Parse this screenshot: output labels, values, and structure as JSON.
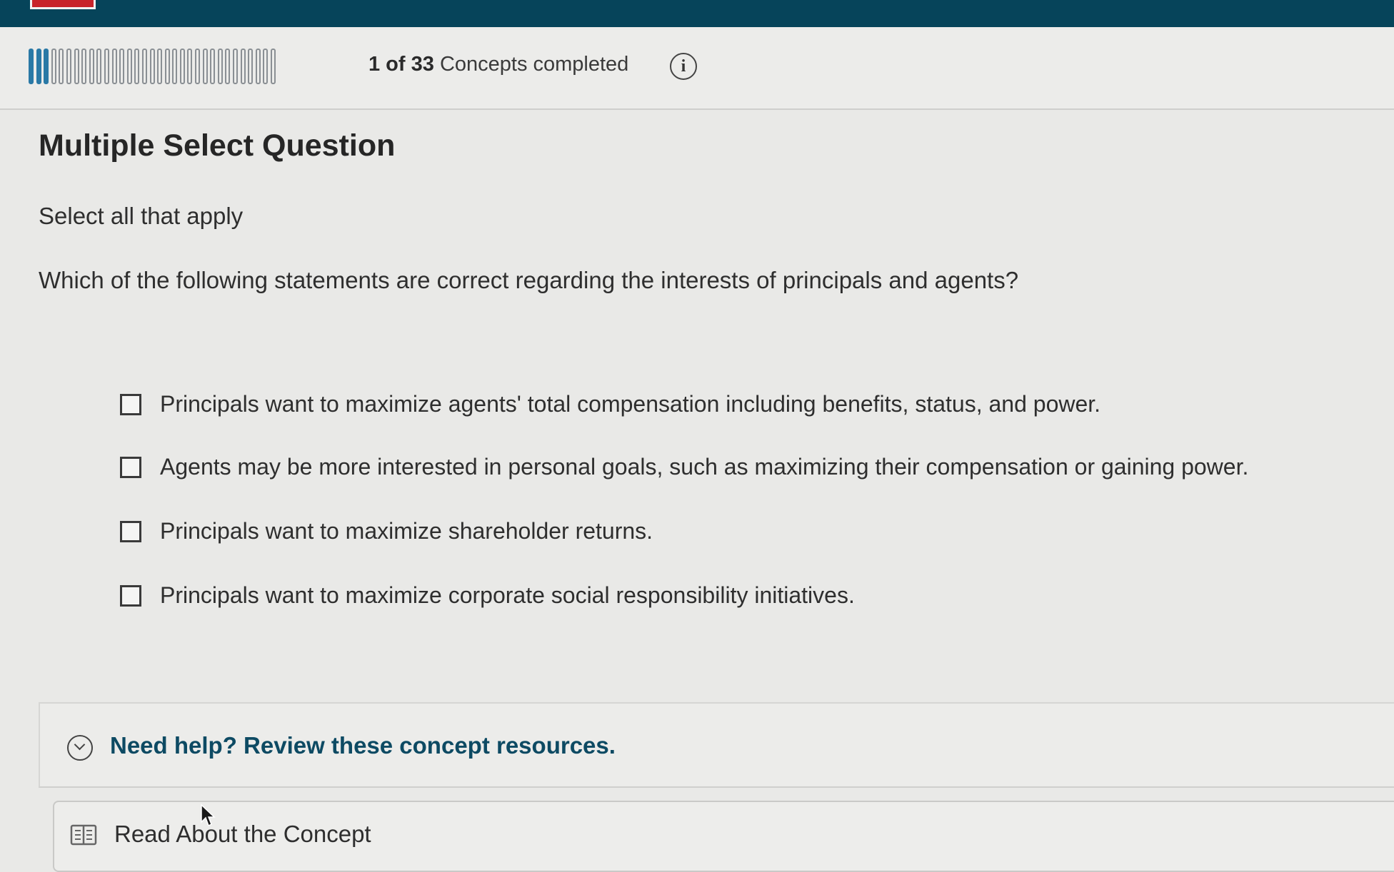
{
  "progress": {
    "completed_count": "1 of 33",
    "label": "Concepts completed",
    "completed": 1,
    "total": 33
  },
  "question": {
    "heading": "Multiple Select Question",
    "instruction": "Select all that apply",
    "prompt": "Which of the following statements are correct regarding the interests of principals and agents?"
  },
  "options": [
    {
      "label": "Principals want to maximize agents' total compensation including benefits, status, and power.",
      "checked": false
    },
    {
      "label": "Agents may be more interested in personal goals, such as maximizing their compensation or gaining power.",
      "checked": false
    },
    {
      "label": "Principals want to maximize shareholder returns.",
      "checked": false
    },
    {
      "label": "Principals want to maximize corporate social responsibility initiatives.",
      "checked": false
    }
  ],
  "help": {
    "label": "Need help? Review these concept resources."
  },
  "resources": {
    "read_concept": "Read About the Concept"
  },
  "icons": {
    "info": "info-icon",
    "expand": "chevron-down-icon",
    "book": "book-icon"
  },
  "colors": {
    "header": "#06445a",
    "progress_fill": "#2a79a6",
    "link": "#0d4a63",
    "brand_chip": "#c8242b"
  }
}
